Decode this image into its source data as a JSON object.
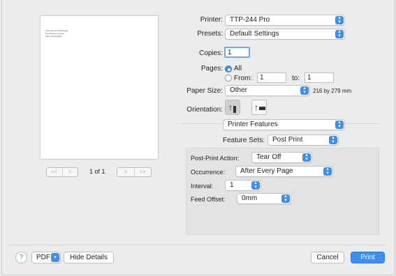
{
  "preview": {
    "sheet_lines": [
      "TSC Auto ID Technology",
      "Pro Version License",
      "Add a 32-bit-EXE"
    ],
    "page_prev_first": "<<",
    "page_prev": "<",
    "page_indicator": "1 of 1",
    "page_next": ">",
    "page_next_last": ">>"
  },
  "printer": {
    "label": "Printer:",
    "value": "TTP-244 Pro"
  },
  "presets": {
    "label": "Presets:",
    "value": "Default Settings"
  },
  "copies": {
    "label": "Copies:",
    "value": "1"
  },
  "pages": {
    "label": "Pages:",
    "all_label": "All",
    "from_label": "From:",
    "from_value": "1",
    "to_label": "to:",
    "to_value": "1",
    "selected": "All"
  },
  "paper_size": {
    "label": "Paper Size:",
    "value": "Other",
    "dimensions": "216 by 279 mm"
  },
  "orientation": {
    "label": "Orientation:",
    "portrait_glyph": "↑",
    "landscape_glyph": "↑",
    "selected": "portrait"
  },
  "section_popup": {
    "value": "Printer Features"
  },
  "feature_sets": {
    "label": "Feature Sets:",
    "value": "Post Print"
  },
  "features": {
    "post_print_action": {
      "label": "Post-Print Action:",
      "value": "Tear Off"
    },
    "occurrence": {
      "label": "Occurrence:",
      "value": "After Every Page"
    },
    "interval": {
      "label": "Interval:",
      "value": "1"
    },
    "feed_offset": {
      "label": "Feed Offset:",
      "value": "0mm"
    }
  },
  "footer": {
    "help": "?",
    "pdf": "PDF",
    "hide_details": "Hide Details",
    "cancel": "Cancel",
    "print": "Print"
  },
  "colors": {
    "accent": "#3e8ef0",
    "background": "#ececec",
    "panel": "#e3e3e3"
  }
}
